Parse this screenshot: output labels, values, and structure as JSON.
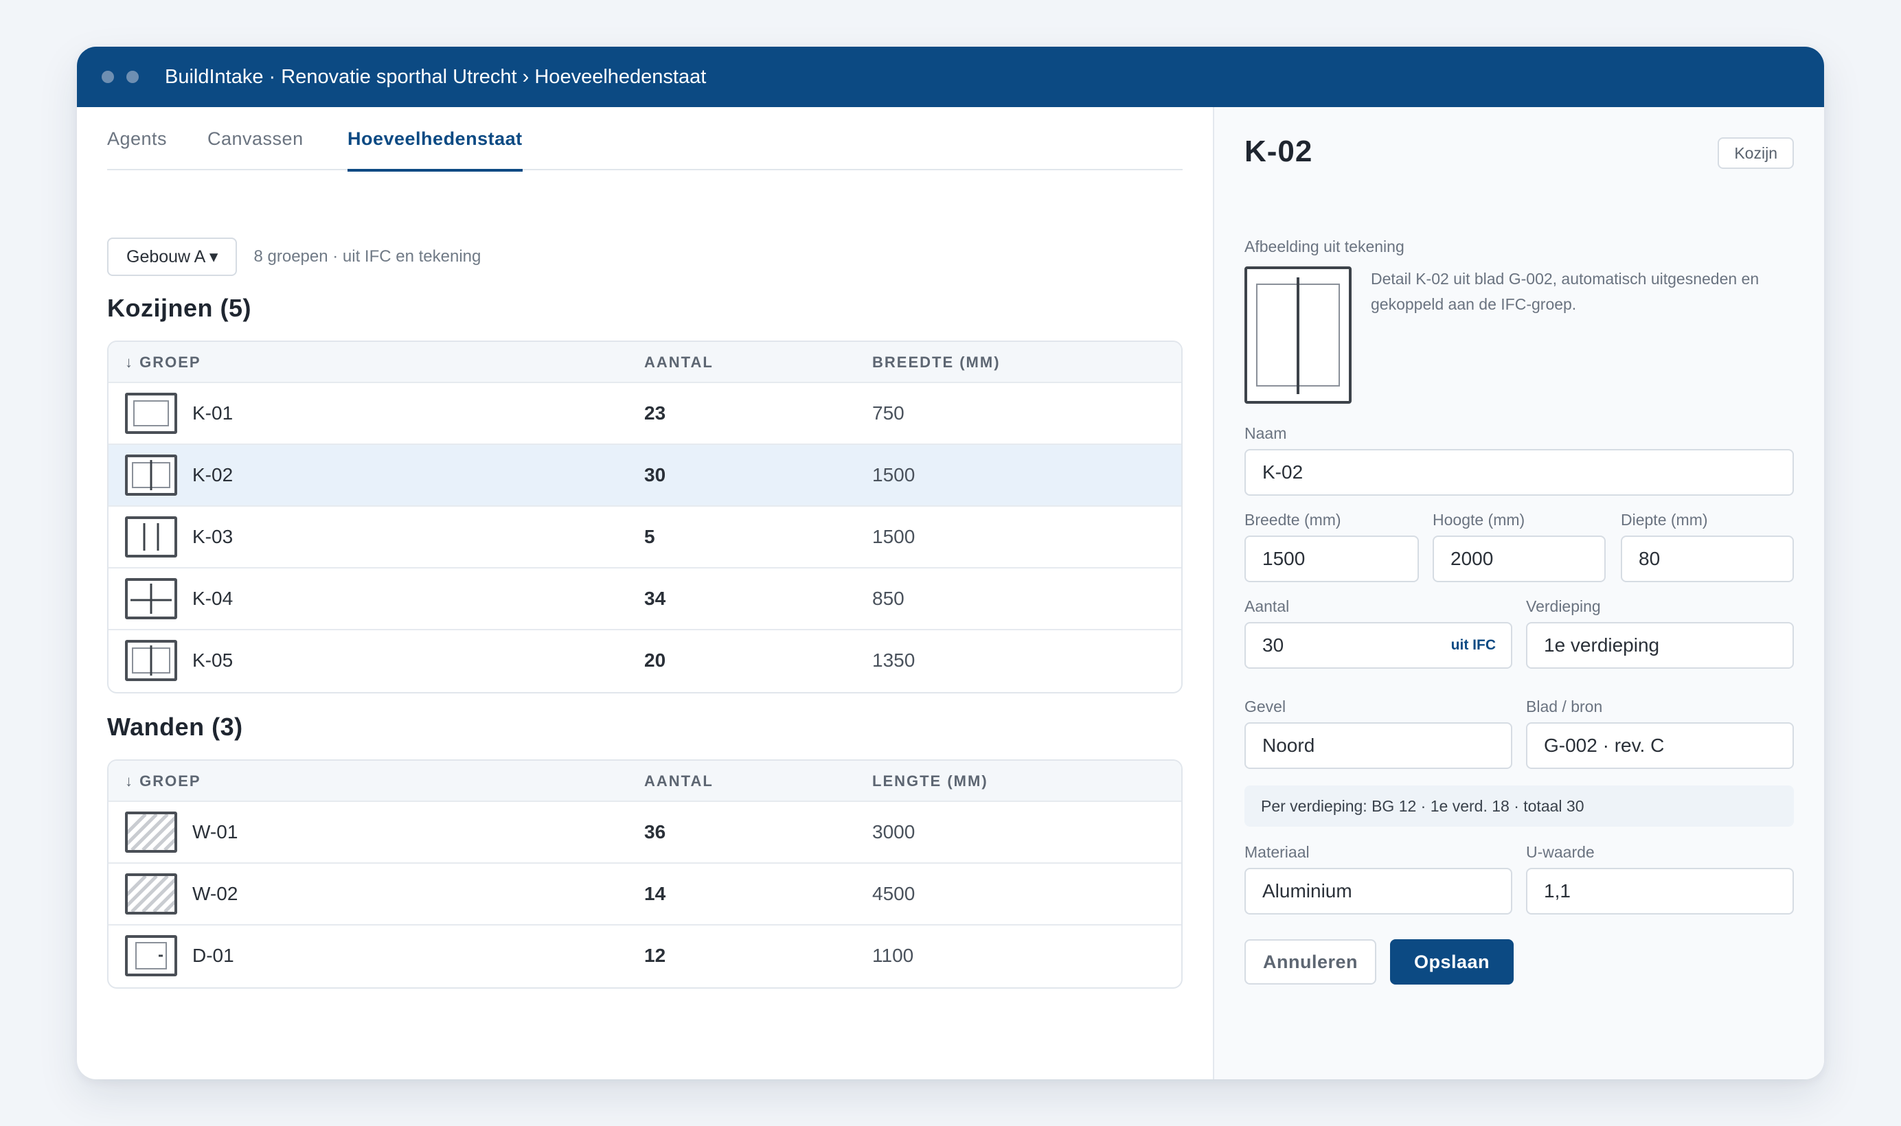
{
  "window": {
    "title": "BuildIntake · Renovatie sporthal Utrecht › Hoeveelhedenstaat"
  },
  "tabs": [
    {
      "label": "Agents",
      "active": false
    },
    {
      "label": "Canvassen",
      "active": false
    },
    {
      "label": "Hoeveelhedenstaat",
      "active": true
    }
  ],
  "filter": {
    "building_select": "Gebouw A ▾",
    "summary": "8 groepen · uit IFC en tekening"
  },
  "sections": [
    {
      "title": "Kozijnen (5)",
      "columns": [
        "↓ GROEP",
        "AANTAL",
        "BREEDTE (MM)"
      ],
      "rows": [
        {
          "name": "K-01",
          "qty": "23",
          "size": "750",
          "icon": "window-single-icon"
        },
        {
          "name": "K-02",
          "qty": "30",
          "size": "1500",
          "icon": "window-double-icon",
          "selected": true
        },
        {
          "name": "K-03",
          "qty": "5",
          "size": "1500",
          "icon": "window-triple-icon"
        },
        {
          "name": "K-04",
          "qty": "34",
          "size": "850",
          "icon": "window-cross-icon"
        },
        {
          "name": "K-05",
          "qty": "20",
          "size": "1350",
          "icon": "window-double-icon"
        }
      ]
    },
    {
      "title": "Wanden (3)",
      "columns": [
        "↓ GROEP",
        "AANTAL",
        "LENGTE (MM)"
      ],
      "rows": [
        {
          "name": "W-01",
          "qty": "36",
          "size": "3000",
          "icon": "wall-hatch-icon"
        },
        {
          "name": "W-02",
          "qty": "14",
          "size": "4500",
          "icon": "wall-hatch-icon"
        },
        {
          "name": "D-01",
          "qty": "12",
          "size": "1100",
          "icon": "door-icon"
        }
      ]
    }
  ],
  "detail": {
    "title": "K-02",
    "type_chip": "Kozijn",
    "image_label": "Afbeelding uit tekening",
    "image_caption": "Detail K-02 uit blad G-002, automatisch uitgesneden en gekoppeld aan de IFC-groep.",
    "fields": {
      "name": {
        "label": "Naam",
        "value": "K-02"
      },
      "width": {
        "label": "Breedte (mm)",
        "value": "1500"
      },
      "height": {
        "label": "Hoogte (mm)",
        "value": "2000"
      },
      "depth": {
        "label": "Diepte (mm)",
        "value": "80"
      },
      "quantity": {
        "label": "Aantal",
        "value": "30",
        "tag": "uit IFC"
      },
      "floor": {
        "label": "Verdieping",
        "value": "1e verdieping"
      },
      "facade": {
        "label": "Gevel",
        "value": "Noord"
      },
      "sheet": {
        "label": "Blad / bron",
        "value": "G-002 · rev. C"
      },
      "material": {
        "label": "Materiaal",
        "value": "Aluminium"
      },
      "u_value": {
        "label": "U-waarde",
        "value": "1,1"
      }
    },
    "per_floor": "Per verdieping: BG 12 · 1e verd. 18 · totaal 30",
    "buttons": {
      "cancel": "Annuleren",
      "save": "Opslaan"
    }
  },
  "colors": {
    "brand": "#0c4a83",
    "selected_row": "#e8f1fa"
  }
}
